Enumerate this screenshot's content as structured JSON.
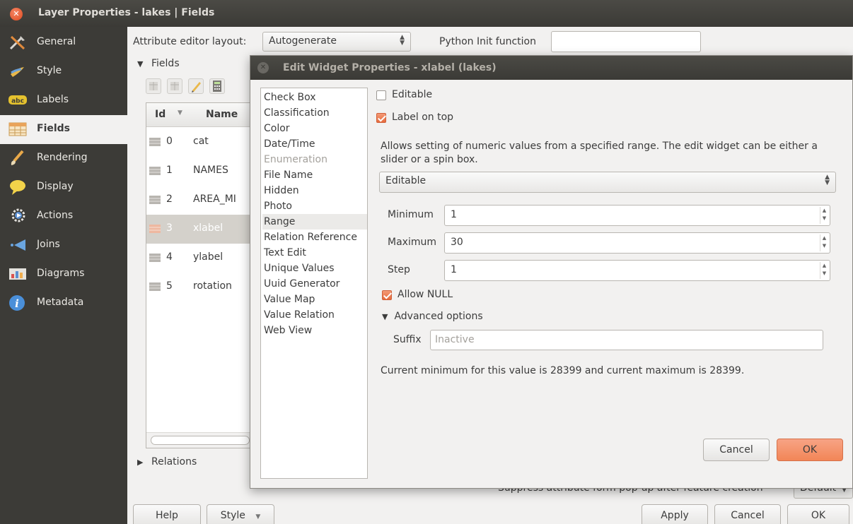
{
  "window": {
    "title": "Layer Properties - lakes | Fields"
  },
  "sidebar": {
    "items": [
      {
        "label": "General",
        "icon": "tools-icon"
      },
      {
        "label": "Style",
        "icon": "brush-icon"
      },
      {
        "label": "Labels",
        "icon": "abc-icon"
      },
      {
        "label": "Fields",
        "icon": "table-icon",
        "active": true
      },
      {
        "label": "Rendering",
        "icon": "paintbrush-icon"
      },
      {
        "label": "Display",
        "icon": "speech-bubble-icon"
      },
      {
        "label": "Actions",
        "icon": "gear-icon"
      },
      {
        "label": "Joins",
        "icon": "join-icon"
      },
      {
        "label": "Diagrams",
        "icon": "chart-icon"
      },
      {
        "label": "Metadata",
        "icon": "info-icon"
      }
    ]
  },
  "main": {
    "attr_layout_label": "Attribute editor layout:",
    "attr_layout_value": "Autogenerate",
    "python_init_label": "Python Init function",
    "python_init_value": "",
    "fields_section": "Fields",
    "relations_section": "Relations",
    "table": {
      "columns": [
        "Id",
        "Name"
      ],
      "rows": [
        {
          "id": "0",
          "name": "cat"
        },
        {
          "id": "1",
          "name": "NAMES"
        },
        {
          "id": "2",
          "name": "AREA_MI"
        },
        {
          "id": "3",
          "name": "xlabel",
          "selected": true
        },
        {
          "id": "4",
          "name": "ylabel"
        },
        {
          "id": "5",
          "name": "rotation"
        }
      ]
    },
    "suppress_label": "Suppress attribute form pop-up after feature creation",
    "suppress_value": "Default",
    "buttons": {
      "help": "Help",
      "style": "Style",
      "apply": "Apply",
      "cancel": "Cancel",
      "ok": "OK"
    }
  },
  "dialog": {
    "title": "Edit Widget Properties - xlabel (lakes)",
    "widgets": [
      {
        "label": "Check Box"
      },
      {
        "label": "Classification"
      },
      {
        "label": "Color"
      },
      {
        "label": "Date/Time"
      },
      {
        "label": "Enumeration",
        "disabled": true
      },
      {
        "label": "File Name"
      },
      {
        "label": "Hidden"
      },
      {
        "label": "Photo"
      },
      {
        "label": "Range",
        "selected": true
      },
      {
        "label": "Relation Reference"
      },
      {
        "label": "Text Edit"
      },
      {
        "label": "Unique Values"
      },
      {
        "label": "Uuid Generator"
      },
      {
        "label": "Value Map"
      },
      {
        "label": "Value Relation"
      },
      {
        "label": "Web View"
      }
    ],
    "editable_label": "Editable",
    "editable_checked": false,
    "label_on_top_label": "Label on top",
    "label_on_top_checked": true,
    "description": "Allows setting of numeric values from a specified range. The edit widget can be either a slider or a spin box.",
    "mode_value": "Editable",
    "minimum_label": "Minimum",
    "minimum_value": "1",
    "maximum_label": "Maximum",
    "maximum_value": "30",
    "step_label": "Step",
    "step_value": "1",
    "allow_null_label": "Allow NULL",
    "allow_null_checked": true,
    "advanced_label": "Advanced options",
    "suffix_label": "Suffix",
    "suffix_placeholder": "Inactive",
    "current_info": "Current minimum for this value is 28399 and current maximum is 28399.",
    "cancel_label": "Cancel",
    "ok_label": "OK"
  },
  "colors": {
    "accent": "#f28657",
    "sidebar_bg": "#3c3b37",
    "titlebar_bg": "#3b3a36",
    "close": "#df4a1e"
  }
}
